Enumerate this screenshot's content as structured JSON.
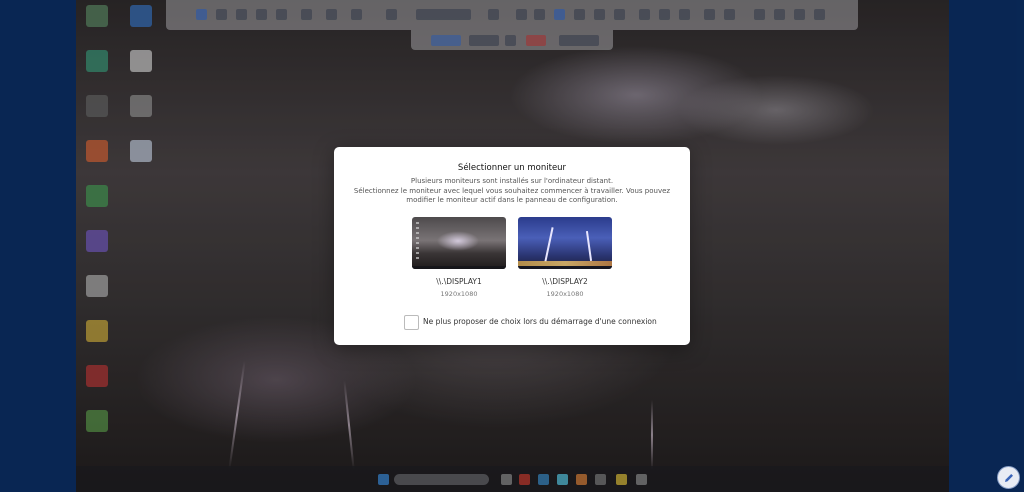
{
  "dialog": {
    "title": "Sélectionner un moniteur",
    "line1": "Plusieurs moniteurs sont installés sur l'ordinateur distant.",
    "line2": "Sélectionnez le moniteur avec lequel vous souhaitez commencer à travailler. Vous pouvez modifier le moniteur actif dans le panneau de configuration.",
    "monitors": [
      {
        "name": "\\\\.\\DISPLAY1",
        "resolution": "1920x1080"
      },
      {
        "name": "\\\\.\\DISPLAY2",
        "resolution": "1920x1080"
      }
    ],
    "checkbox_label": "Ne plus proposer de choix lors du démarrage d'une connexion",
    "checkbox_checked": false
  },
  "colors": {
    "outer_bg": "#0b2f66",
    "modal_bg": "#ffffff",
    "accent": "#3a64b8"
  },
  "icons": {
    "edit_button": "pencil-icon"
  }
}
